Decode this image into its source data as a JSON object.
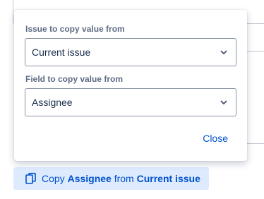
{
  "popup": {
    "source_label": "Issue to copy value from",
    "source_value": "Current issue",
    "field_label": "Field to copy value from",
    "field_value": "Assignee",
    "close_label": "Close"
  },
  "copy_action": {
    "prefix": "Copy",
    "field": "Assignee",
    "middle": "from",
    "source": "Current issue"
  },
  "icons": {
    "copy": "copy-icon",
    "chevron": "chevron-down-icon"
  },
  "colors": {
    "accent": "#0052cc",
    "action_bg": "#deebff",
    "label": "#5e6c84"
  }
}
